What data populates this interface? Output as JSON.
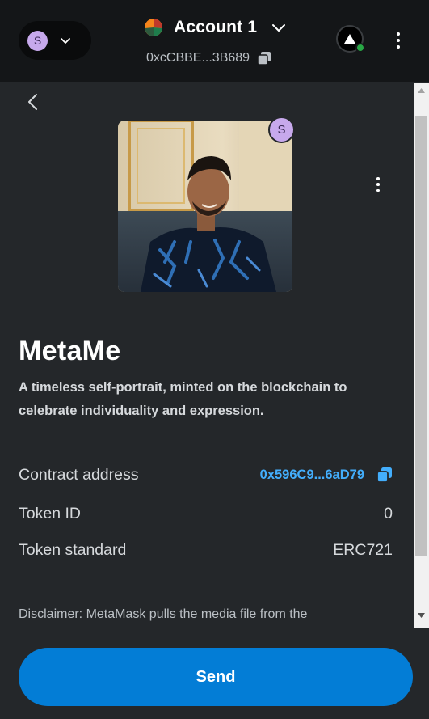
{
  "header": {
    "network_initial": "S",
    "account_name": "Account 1",
    "address": "0xcCBBE...3B689"
  },
  "nft": {
    "badge_initial": "S",
    "title": "MetaMe",
    "description": "A timeless self-portrait, minted on the blockchain to celebrate individuality and expression.",
    "details": {
      "contract_label": "Contract address",
      "contract_value": "0x596C9...6aD79",
      "token_id_label": "Token ID",
      "token_id_value": "0",
      "standard_label": "Token standard",
      "standard_value": "ERC721"
    },
    "disclaimer": "Disclaimer: MetaMask pulls the media file from the"
  },
  "footer": {
    "send_label": "Send"
  },
  "colors": {
    "background": "#24272a",
    "header_bg": "#141618",
    "primary": "#037dd6",
    "link": "#43aefc",
    "avatar": "#c7a9ec",
    "connected": "#28a745"
  },
  "icons": [
    "chevron-down-icon",
    "fox-icon",
    "copy-icon",
    "connected-site-icon",
    "kebab-menu-icon",
    "back-arrow-icon",
    "scroll-up-icon",
    "scroll-down-icon"
  ]
}
